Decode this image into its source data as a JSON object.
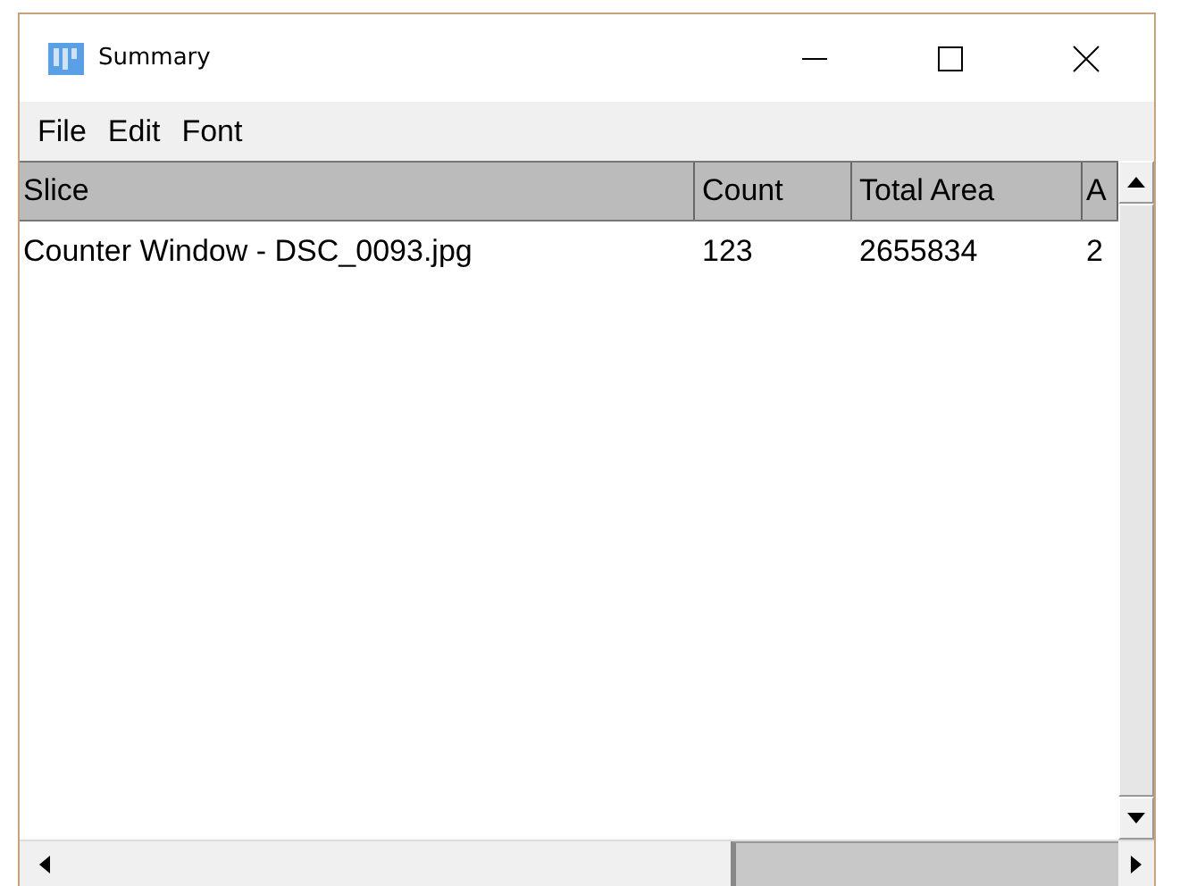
{
  "window": {
    "title": "Summary"
  },
  "menu": [
    "File",
    "Edit",
    "Font"
  ],
  "table": {
    "columns": [
      "Slice",
      "Count",
      "Total Area",
      "A"
    ],
    "rows": [
      [
        "Counter Window - DSC_0093.jpg",
        "123",
        "2655834",
        "2"
      ]
    ]
  }
}
